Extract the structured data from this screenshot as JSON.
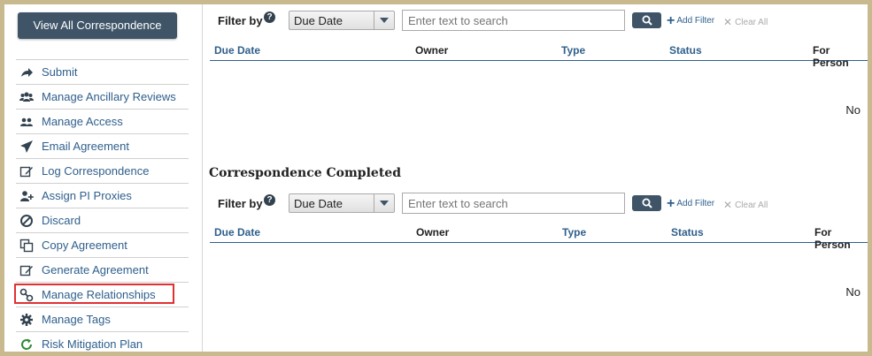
{
  "sidebar": {
    "view_all": "View All Correspondence",
    "items": [
      {
        "label": "Submit",
        "icon": "share-arrow-icon"
      },
      {
        "label": "Manage Ancillary Reviews",
        "icon": "users-icon"
      },
      {
        "label": "Manage Access",
        "icon": "user-group-icon"
      },
      {
        "label": "Email Agreement",
        "icon": "paper-plane-icon"
      },
      {
        "label": "Log Correspondence",
        "icon": "edit-icon"
      },
      {
        "label": "Assign PI Proxies",
        "icon": "user-plus-icon"
      },
      {
        "label": "Discard",
        "icon": "ban-icon"
      },
      {
        "label": "Copy Agreement",
        "icon": "copy-icon"
      },
      {
        "label": "Generate Agreement",
        "icon": "edit-icon"
      },
      {
        "label": "Manage Relationships",
        "icon": "link-icon"
      },
      {
        "label": "Manage Tags",
        "icon": "gear-icon"
      },
      {
        "label": "Risk Mitigation Plan",
        "icon": "refresh-icon"
      }
    ]
  },
  "sections": [
    {
      "title": "",
      "filter_label": "Filter by",
      "select_value": "Due Date",
      "search_placeholder": "Enter text to search",
      "add_filter": "Add Filter",
      "clear_all": "Clear All",
      "columns": [
        "Due Date",
        "Owner",
        "Type",
        "Status",
        "For Person"
      ],
      "empty_text": "No"
    },
    {
      "title": "Correspondence Completed",
      "filter_label": "Filter by",
      "select_value": "Due Date",
      "search_placeholder": "Enter text to search",
      "add_filter": "Add Filter",
      "clear_all": "Clear All",
      "columns": [
        "Due Date",
        "Owner",
        "Type",
        "Status",
        "For Person"
      ],
      "empty_text": "No"
    }
  ],
  "colors": {
    "accent": "#3f5567",
    "link": "#2f5f8c",
    "highlight": "#e03131",
    "frame": "#c9b98f"
  }
}
